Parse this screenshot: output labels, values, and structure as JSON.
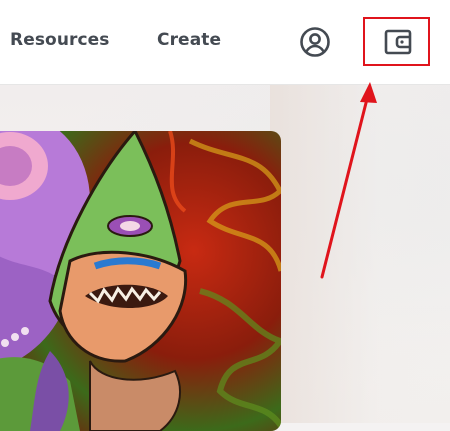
{
  "nav": {
    "resources_label": "Resources",
    "create_label": "Create"
  },
  "icons": {
    "account": "account-circle-icon",
    "wallet": "wallet-icon"
  },
  "colors": {
    "nav_text": "#444a52",
    "highlight": "#e0141c",
    "arrow": "#e0141c"
  }
}
